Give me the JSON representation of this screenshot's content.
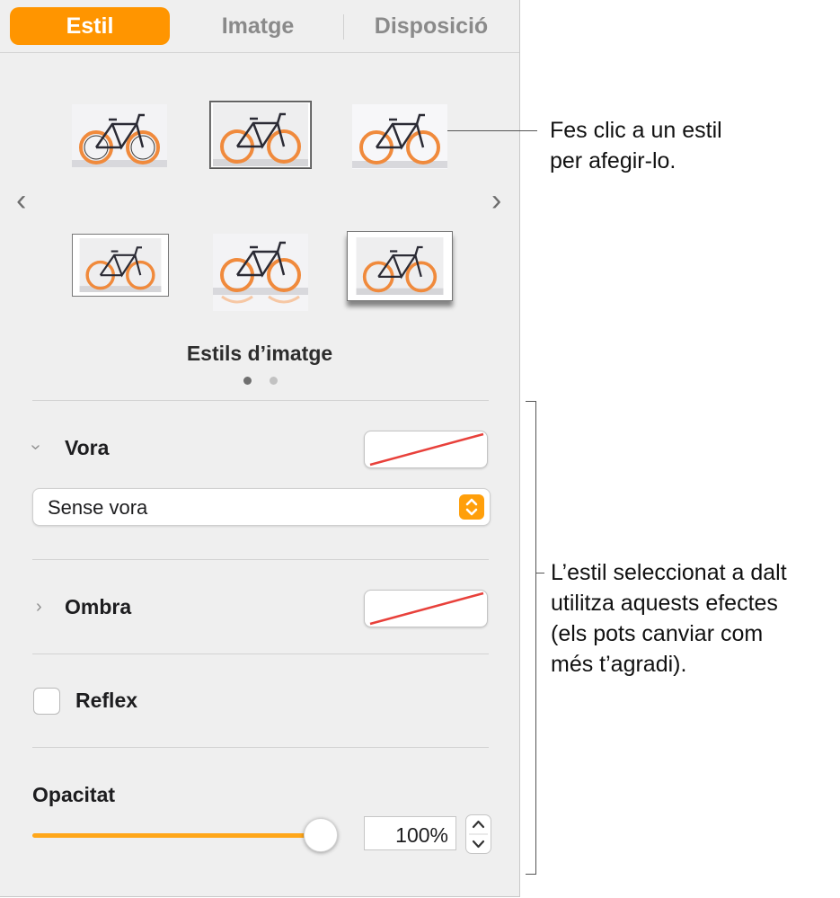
{
  "tabs": [
    {
      "label": "Estil",
      "active": true
    },
    {
      "label": "Imatge",
      "active": false
    },
    {
      "label": "Disposició",
      "active": false
    }
  ],
  "styles": {
    "caption": "Estils d’imatge",
    "items": [
      {
        "style": "plain",
        "selected": false
      },
      {
        "style": "thin-border",
        "selected": true
      },
      {
        "style": "soft-edge",
        "selected": false
      },
      {
        "style": "framed",
        "selected": false
      },
      {
        "style": "reflection",
        "selected": false
      },
      {
        "style": "curved-shadow",
        "selected": false
      }
    ],
    "page_count": 2,
    "current_page": 1,
    "prev_icon": "chevron-left-icon",
    "next_icon": "chevron-right-icon"
  },
  "border": {
    "label": "Vora",
    "expanded": true,
    "popup_value": "Sense vora",
    "swatch": "none"
  },
  "shadow": {
    "label": "Ombra",
    "expanded": false,
    "swatch": "none"
  },
  "reflection": {
    "label": "Reflex",
    "checked": false
  },
  "opacity": {
    "label": "Opacitat",
    "value_text": "100%",
    "value": 100
  },
  "callouts": {
    "styles": "Fes clic a un estil\nper afegir-lo.",
    "effects": "L’estil seleccionat a dalt\nutilitza aquests efectes\n(els pots canviar com\nmés t’agradi)."
  },
  "colors": {
    "accent": "#ff9500",
    "slider": "#ffa71a",
    "no_color_line": "#e8413b"
  }
}
